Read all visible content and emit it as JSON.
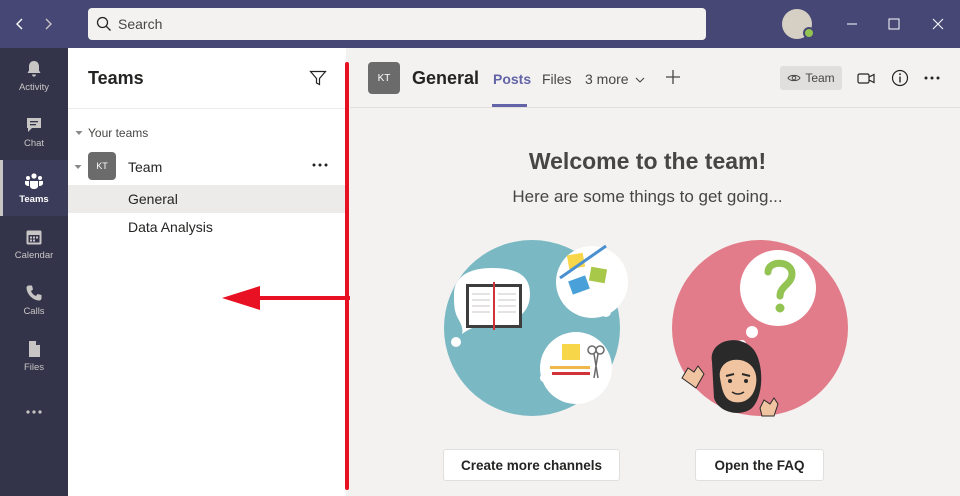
{
  "search": {
    "placeholder": "Search"
  },
  "rail": [
    {
      "id": "activity",
      "label": "Activity",
      "icon": "bell-icon"
    },
    {
      "id": "chat",
      "label": "Chat",
      "icon": "chat-icon"
    },
    {
      "id": "teams",
      "label": "Teams",
      "icon": "teams-icon",
      "active": true
    },
    {
      "id": "calendar",
      "label": "Calendar",
      "icon": "calendar-icon"
    },
    {
      "id": "calls",
      "label": "Calls",
      "icon": "phone-icon"
    },
    {
      "id": "files",
      "label": "Files",
      "icon": "file-icon"
    }
  ],
  "teams_panel": {
    "title": "Teams",
    "section_label": "Your teams",
    "team": {
      "initials": "KT",
      "name": "Team"
    },
    "channels": [
      {
        "name": "General",
        "selected": true
      },
      {
        "name": "Data Analysis",
        "selected": false
      }
    ]
  },
  "channel_header": {
    "initials": "KT",
    "title": "General",
    "tabs": [
      {
        "label": "Posts",
        "active": true
      },
      {
        "label": "Files",
        "active": false
      },
      {
        "label": "3 more",
        "active": false
      }
    ],
    "team_button": "Team"
  },
  "welcome": {
    "title": "Welcome to the team!",
    "subtitle": "Here are some things to get going...",
    "create_channels": "Create more channels",
    "open_faq": "Open the FAQ"
  },
  "colors": {
    "titlebar": "#464775",
    "rail": "#33344a",
    "accent": "#6264a7",
    "annotation": "#e81123"
  }
}
